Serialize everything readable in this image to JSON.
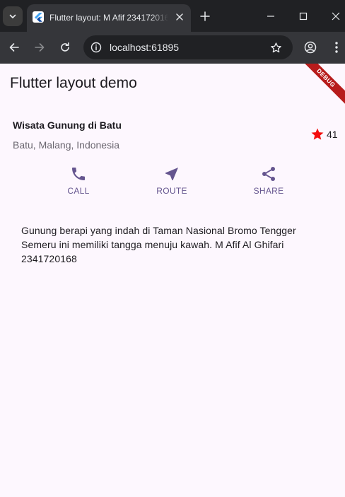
{
  "browser": {
    "tab": {
      "title": "Flutter layout: M Afif 2341720168",
      "favicon": "flutter-icon"
    },
    "address_bar": {
      "url": "localhost:61895"
    },
    "icons": {
      "tab_search": "chevron-down-icon",
      "tab_close": "close-icon",
      "new_tab": "plus-icon",
      "minimize": "minimize-icon",
      "maximize": "maximize-icon",
      "close": "close-icon",
      "back": "arrow-left-icon",
      "forward": "arrow-right-icon",
      "reload": "reload-icon",
      "site_info": "info-icon",
      "bookmark": "star-outline-icon",
      "profile": "profile-icon",
      "menu": "more-vert-icon"
    },
    "colors": {
      "tabstrip": "#202124",
      "toolbar": "#35363a"
    }
  },
  "app": {
    "appbar_title": "Flutter layout demo",
    "debug_banner": "DEBUG",
    "title_section": {
      "name": "Wisata Gunung di Batu",
      "location": "Batu, Malang, Indonesia",
      "rating_icon": "star-icon",
      "rating_count": "41"
    },
    "actions": [
      {
        "label": "CALL",
        "icon": "phone-icon"
      },
      {
        "label": "ROUTE",
        "icon": "near-me-icon"
      },
      {
        "label": "SHARE",
        "icon": "share-icon"
      }
    ],
    "description": "Gunung berapi yang indah di Taman Nasional Bromo Tengger Semeru ini memiliki tangga menuju kawah. M Afif Al Ghifari 2341720168",
    "colors": {
      "background": "#fdf7fe",
      "accent": "#65558f",
      "star": "#f40d0d",
      "debug_banner": "#b71c1c"
    }
  }
}
